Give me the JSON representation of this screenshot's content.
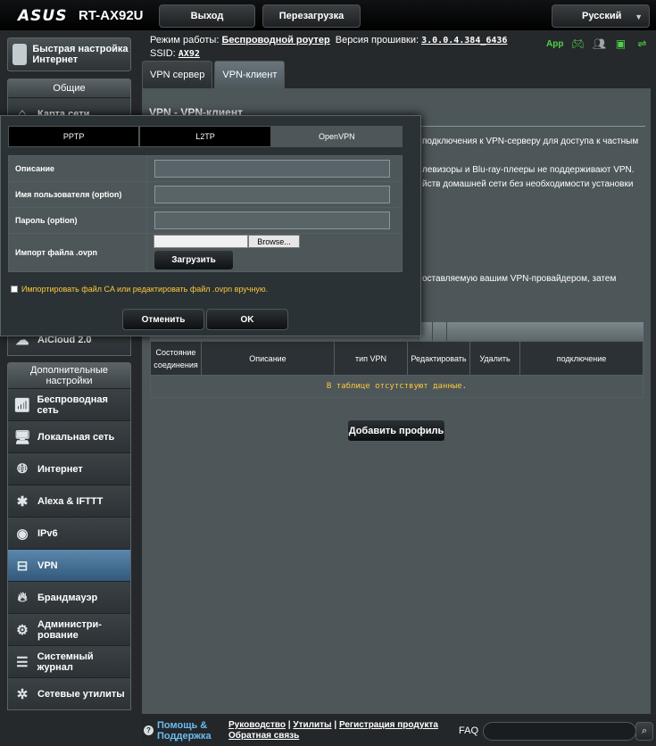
{
  "header": {
    "brand": "ASUS",
    "model": "RT-AX92U",
    "logout_label": "Выход",
    "reboot_label": "Перезагрузка",
    "language": "Русский"
  },
  "status": {
    "mode_label": "Режим работы:",
    "mode_value": "Беспроводной роутер",
    "fw_label": "Версия прошивки:",
    "fw_value": "3.0.0.4.384_6436",
    "ssid_label": "SSID:",
    "ssid_value": "AX92",
    "app_label": "App"
  },
  "sidebar": {
    "qis_label": "Быстрая настройка Интернет",
    "general_header": "Общие",
    "general_items": [
      {
        "label": "Карта сети"
      },
      {
        "label": "AiCloud 2.0"
      }
    ],
    "advanced_header": "Дополнительные настройки",
    "advanced_items": [
      {
        "label": "Беспроводная сеть",
        "icon": "wifi-icon"
      },
      {
        "label": "Локальная сеть",
        "icon": "lan-icon"
      },
      {
        "label": "Интернет",
        "icon": "globe-icon"
      },
      {
        "label": "Alexa & IFTTT",
        "icon": "alexa-icon"
      },
      {
        "label": "IPv6",
        "icon": "ipv6-icon"
      },
      {
        "label": "VPN",
        "icon": "vpn-icon"
      },
      {
        "label": "Брандмауэр",
        "icon": "firewall-icon"
      },
      {
        "label": "Администри-рование",
        "icon": "admin-icon"
      },
      {
        "label": "Системный журнал",
        "icon": "log-icon"
      },
      {
        "label": "Сетевые утилиты",
        "icon": "tools-icon"
      }
    ]
  },
  "tabs": [
    {
      "label": "VPN сервер"
    },
    {
      "label": "VPN-клиент"
    }
  ],
  "main": {
    "title": "VPN - VPN-клиент",
    "desc1": "подключения к VPN-серверу для доступа к частным",
    "desc2": "левизоры и Blu-ray-плееры не поддерживают VPN.",
    "desc3": "йств домашней сети без необходимости установки",
    "desc4": "оставляемую вашим VPN-провайдером, затем",
    "table_headers": [
      "Состояние соединения",
      "Описание",
      "тип VPN",
      "Редактировать",
      "Удалить",
      "подключение"
    ],
    "empty_text": "В таблице отсутствуют данные.",
    "add_profile": "Добавить профиль"
  },
  "dialog": {
    "protocols": [
      "PPTP",
      "L2TP",
      "OpenVPN"
    ],
    "active_protocol": "OpenVPN",
    "description_label": "Описание",
    "username_label": "Имя пользователя (option)",
    "password_label": "Пароль (option)",
    "import_label": "Импорт файла .ovpn",
    "browse_label": "Browse...",
    "upload_label": "Загрузить",
    "ca_label": "Импортировать файл CA или редактировать файл .ovpn вручную.",
    "cancel_label": "Отменить",
    "ok_label": "OK"
  },
  "footer": {
    "help": "Помощь & Поддержка",
    "manual": "Руководство",
    "utility": "Утилиты",
    "register": "Регистрация продукта",
    "feedback": "Обратная связь",
    "faq": "FAQ"
  }
}
